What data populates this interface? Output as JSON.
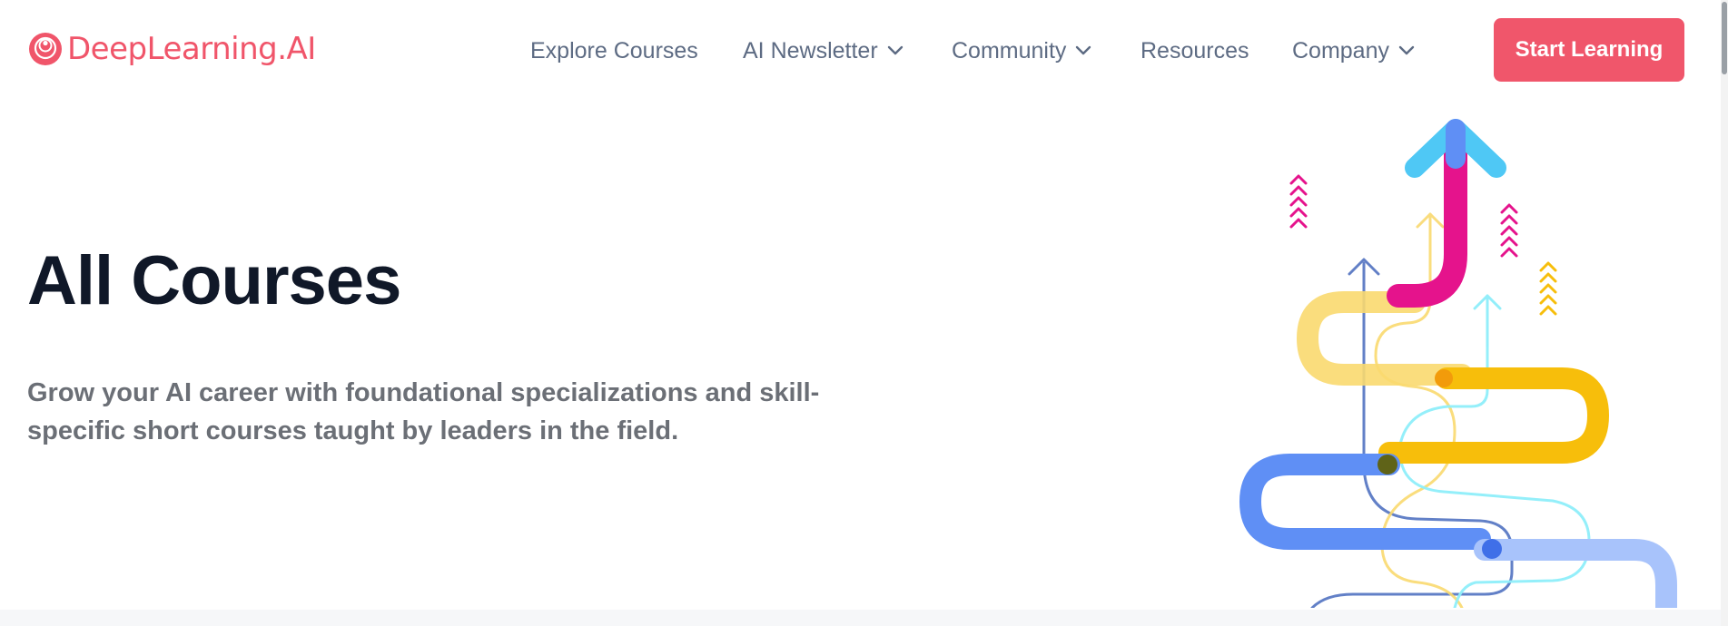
{
  "brand": {
    "name": "DeepLearning.AI",
    "color": "#f0556a"
  },
  "nav": {
    "items": [
      {
        "label": "Explore Courses",
        "has_dropdown": false
      },
      {
        "label": "AI Newsletter",
        "has_dropdown": true
      },
      {
        "label": "Community",
        "has_dropdown": true
      },
      {
        "label": "Resources",
        "has_dropdown": false
      },
      {
        "label": "Company",
        "has_dropdown": true
      }
    ],
    "dropdown_icon": "chevron-down-icon",
    "cta_label": "Start Learning",
    "cta_color": "#f0566b"
  },
  "hero": {
    "title": "All Courses",
    "subtitle": "Grow your AI career with foundational specializations and skill-specific short courses taught by leaders in the field."
  },
  "illustration": {
    "icon": "growth-arrows-illustration",
    "colors": {
      "magenta": "#e5138c",
      "sky": "#4fc8f5",
      "yellow": "#f7be0b",
      "pale_yellow": "#f9d96f",
      "blue": "#5f8ff5",
      "light_blue": "#a8c3fb",
      "navy": "#5a79c4",
      "cyan": "#8eeefa"
    }
  }
}
